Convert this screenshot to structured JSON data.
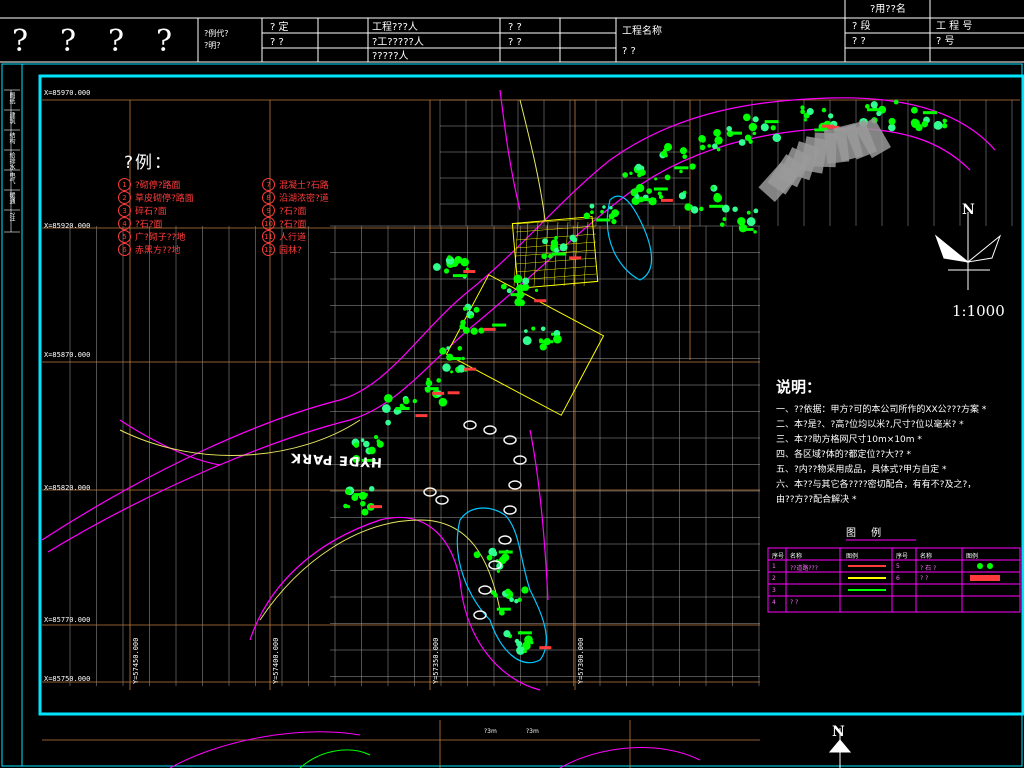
{
  "title_block": {
    "question_marks": [
      "?",
      "?",
      "?",
      "?"
    ],
    "cell_a1": "?例代?",
    "cell_a2": "?明?",
    "cell_b1": "?    定",
    "cell_b2": "?    ?",
    "cell_c1": "工程???人",
    "cell_c2": "?工?????人",
    "cell_c3": "?????人",
    "cell_d1": "?      ?",
    "cell_d2": "?      ?",
    "cell_e1": "工程名称",
    "cell_e2": "?    ?",
    "cell_f0": "?用??名",
    "cell_f1": "? 段",
    "cell_f2": "工 程 号",
    "cell_f3": "?      ?",
    "cell_f4": "?  号"
  },
  "coordinates": {
    "x_labels": [
      "X=85970.000",
      "X=85920.000",
      "X=85870.000",
      "X=85820.000",
      "X=85770.000",
      "X=85750.000"
    ],
    "y_labels": [
      "Y=57450.000",
      "Y=57400.000",
      "Y=57350.000",
      "Y=57300.000"
    ]
  },
  "legend": {
    "title": "?例：",
    "items_left": [
      {
        "num": "1",
        "label": "?砌停?路面"
      },
      {
        "num": "2",
        "label": "草皮砌停?路面"
      },
      {
        "num": "3",
        "label": "碎石?面"
      },
      {
        "num": "4",
        "label": "?石?面"
      },
      {
        "num": "5",
        "label": "广?砌子??地"
      },
      {
        "num": "6",
        "label": "赤黑方??地"
      }
    ],
    "items_right": [
      {
        "num": "7",
        "label": "混凝土?石路"
      },
      {
        "num": "8",
        "label": "沿湖浓密?道"
      },
      {
        "num": "9",
        "label": "?石?面"
      },
      {
        "num": "10",
        "label": "?石?面"
      },
      {
        "num": "11",
        "label": "人行道"
      },
      {
        "num": "12",
        "label": "园林?"
      }
    ]
  },
  "sidebar_cells": [
    "图纸",
    "建筑",
    "结构",
    "给排水",
    "电气",
    "暖通",
    "?注"
  ],
  "park_label": "HYDE PARK",
  "scale": "1:1000",
  "north": "N",
  "notes": {
    "title": "说明：",
    "lines": [
      "一、??依据：甲方?可的本公司所作的XX公???方案 *",
      "二、本?是?、?高?位均以米?,尺寸?位以毫米? *",
      "三、本??助方格网尺寸10m×10m *",
      "四、各区域?体的?都定位??大?? *",
      "五、?内??物采用成品，具体式?甲方自定 *",
      "六、本??与其它各????密切配合，有有不?及之?，",
      "     由??方??配合解决 *"
    ]
  },
  "legend_table": {
    "title": "图 例",
    "headers": [
      "序号",
      "名称",
      "图例",
      "序号",
      "名称",
      "图例"
    ],
    "rows": [
      [
        "1",
        "??道路???",
        "",
        "5",
        "? 石 ?",
        ""
      ],
      [
        "2",
        "",
        "",
        "6",
        "? ?",
        ""
      ],
      [
        "3",
        "",
        "",
        "",
        "",
        ""
      ],
      [
        "4",
        "? ?",
        "",
        "",
        "",
        ""
      ]
    ]
  },
  "bottom_labels": [
    "?3m",
    "?3m"
  ],
  "colors": {
    "frame": "#00e5ff",
    "grid": "#ffffff",
    "contour": "#ff00ff",
    "plant": "#00ff00",
    "plaza": "#ffff00",
    "legend_text": "#ff3b3b"
  }
}
